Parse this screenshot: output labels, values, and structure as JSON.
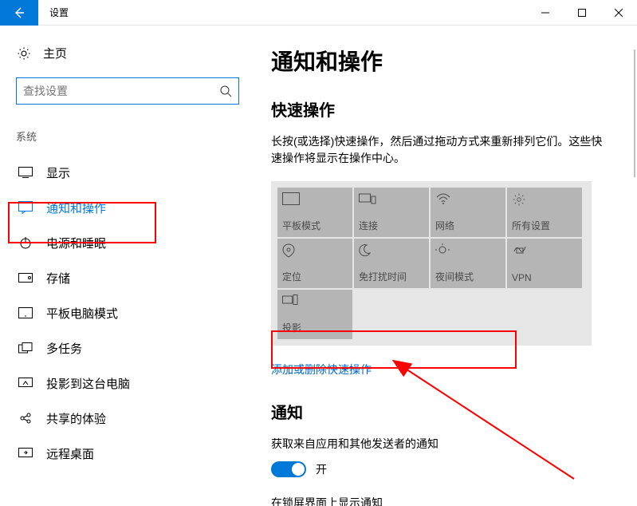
{
  "window": {
    "title": "设置",
    "controls": {
      "min": "—",
      "max": "□",
      "close": "✕"
    }
  },
  "sidebar": {
    "home": "主页",
    "search_placeholder": "查找设置",
    "section": "系统",
    "items": [
      {
        "icon": "display-icon",
        "label": "显示"
      },
      {
        "icon": "notifications-icon",
        "label": "通知和操作"
      },
      {
        "icon": "power-icon",
        "label": "电源和睡眠"
      },
      {
        "icon": "storage-icon",
        "label": "存储"
      },
      {
        "icon": "tablet-icon",
        "label": "平板电脑模式"
      },
      {
        "icon": "multitask-icon",
        "label": "多任务"
      },
      {
        "icon": "project-icon",
        "label": "投影到这台电脑"
      },
      {
        "icon": "shared-icon",
        "label": "共享的体验"
      },
      {
        "icon": "remote-icon",
        "label": "远程桌面"
      }
    ]
  },
  "main": {
    "title": "通知和操作",
    "quick_actions": {
      "heading": "快速操作",
      "desc": "长按(或选择)快速操作，然后通过拖动方式来重新排列它们。这些快速操作将显示在操作中心。",
      "tiles": [
        {
          "label": "平板模式"
        },
        {
          "label": "连接"
        },
        {
          "label": "网络"
        },
        {
          "label": "所有设置"
        },
        {
          "label": "定位"
        },
        {
          "label": "免打扰时间"
        },
        {
          "label": "夜间模式"
        },
        {
          "label": "VPN"
        },
        {
          "label": "投影"
        }
      ],
      "link": "添加或删除快速操作"
    },
    "notifications": {
      "heading": "通知",
      "desc": "获取来自应用和其他发送者的通知",
      "toggle_label": "开",
      "toggle_on": true,
      "lock": "在锁屏界面上显示通知"
    }
  }
}
